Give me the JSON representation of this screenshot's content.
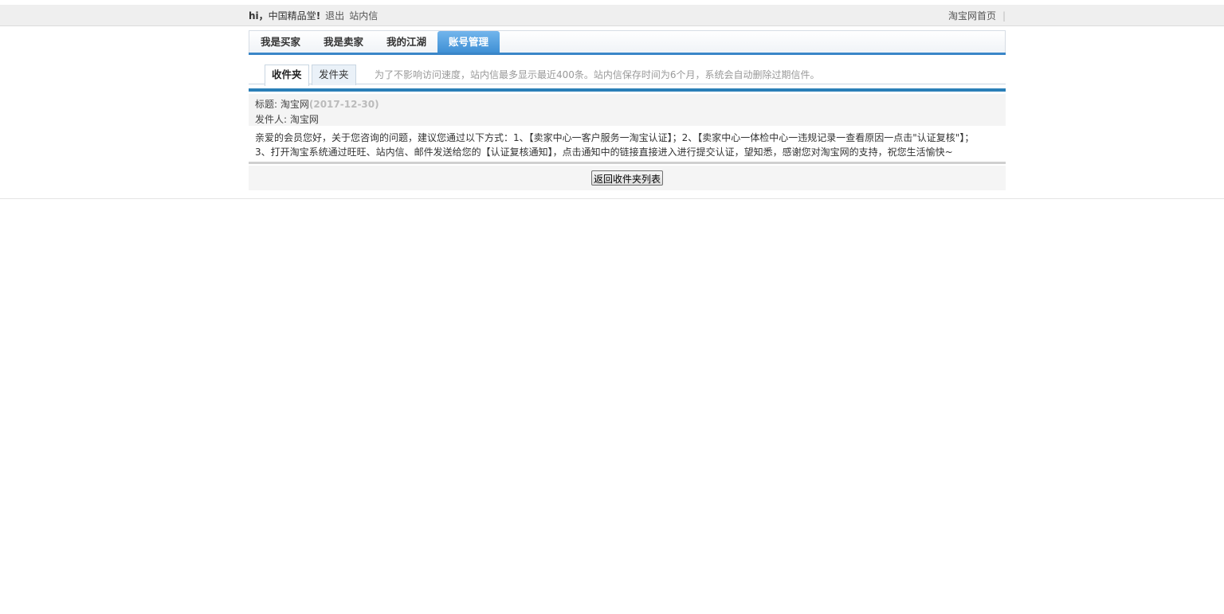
{
  "topbar": {
    "greeting": "hi，",
    "username": "中国精品堂",
    "exclaim": "!",
    "logout": "退出",
    "messages": "站内信",
    "home_link": "淘宝网首页",
    "divider": "|"
  },
  "nav": {
    "tabs": [
      {
        "label": "我是买家"
      },
      {
        "label": "我是卖家"
      },
      {
        "label": "我的江湖"
      },
      {
        "label": "账号管理",
        "active": true
      }
    ]
  },
  "subtabs": {
    "inbox": "收件夹",
    "outbox": "发件夹",
    "notice": "为了不影响访问速度，站内信最多显示最近400条。站内信保存时间为6个月，系统会自动删除过期信件。"
  },
  "message": {
    "title_label": "标题: ",
    "title": "淘宝网",
    "date": "(2017-12-30)",
    "sender_label": "发件人: ",
    "sender": "淘宝网",
    "body_line1": "亲爱的会员您好，关于您咨询的问题，建议您通过以下方式：1、【卖家中心一客户服务一淘宝认证】；2、【卖家中心一体检中心一违规记录一查看原因一点击\"认证复核\"】；",
    "body_line2": "3、打开淘宝系统通过旺旺、站内信、邮件发送给您的【认证复核通知】，点击通知中的链接直接进入进行提交认证，望知悉，感谢您对淘宝网的支持，祝您生活愉快~"
  },
  "footer": {
    "back_button": "返回收件夹列表"
  },
  "colors": {
    "nav_accent": "#3a86c8",
    "active_tab": "#4a98d9",
    "message_bar": "#2a7fb8"
  }
}
